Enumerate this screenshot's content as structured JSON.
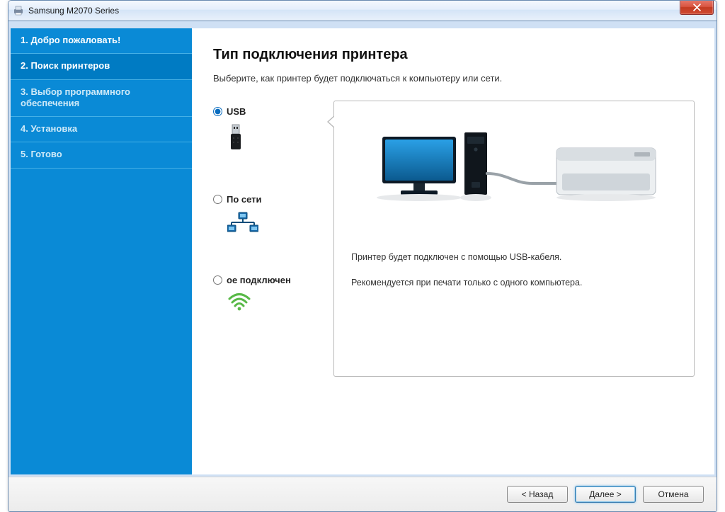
{
  "window": {
    "title": "Samsung M2070 Series"
  },
  "sidebar": {
    "steps": [
      "1. Добро пожаловать!",
      "2. Поиск принтеров",
      "3. Выбор программного обеспечения",
      "4. Установка",
      "5. Готово"
    ],
    "active_index": 1
  },
  "main": {
    "heading": "Тип подключения принтера",
    "subtitle": "Выберите, как принтер будет подключаться к компьютеру или сети.",
    "options": {
      "usb": {
        "label": "USB",
        "selected": true
      },
      "network": {
        "label": "По сети",
        "selected": false
      },
      "wireless": {
        "label": "ое подключен",
        "selected": false
      }
    },
    "panel": {
      "line1": "Принтер будет подключен с помощью USB-кабеля.",
      "line2": "Рекомендуется при печати только с одного компьютера."
    }
  },
  "footer": {
    "back": "< Назад",
    "next": "Далее >",
    "cancel": "Отмена"
  }
}
